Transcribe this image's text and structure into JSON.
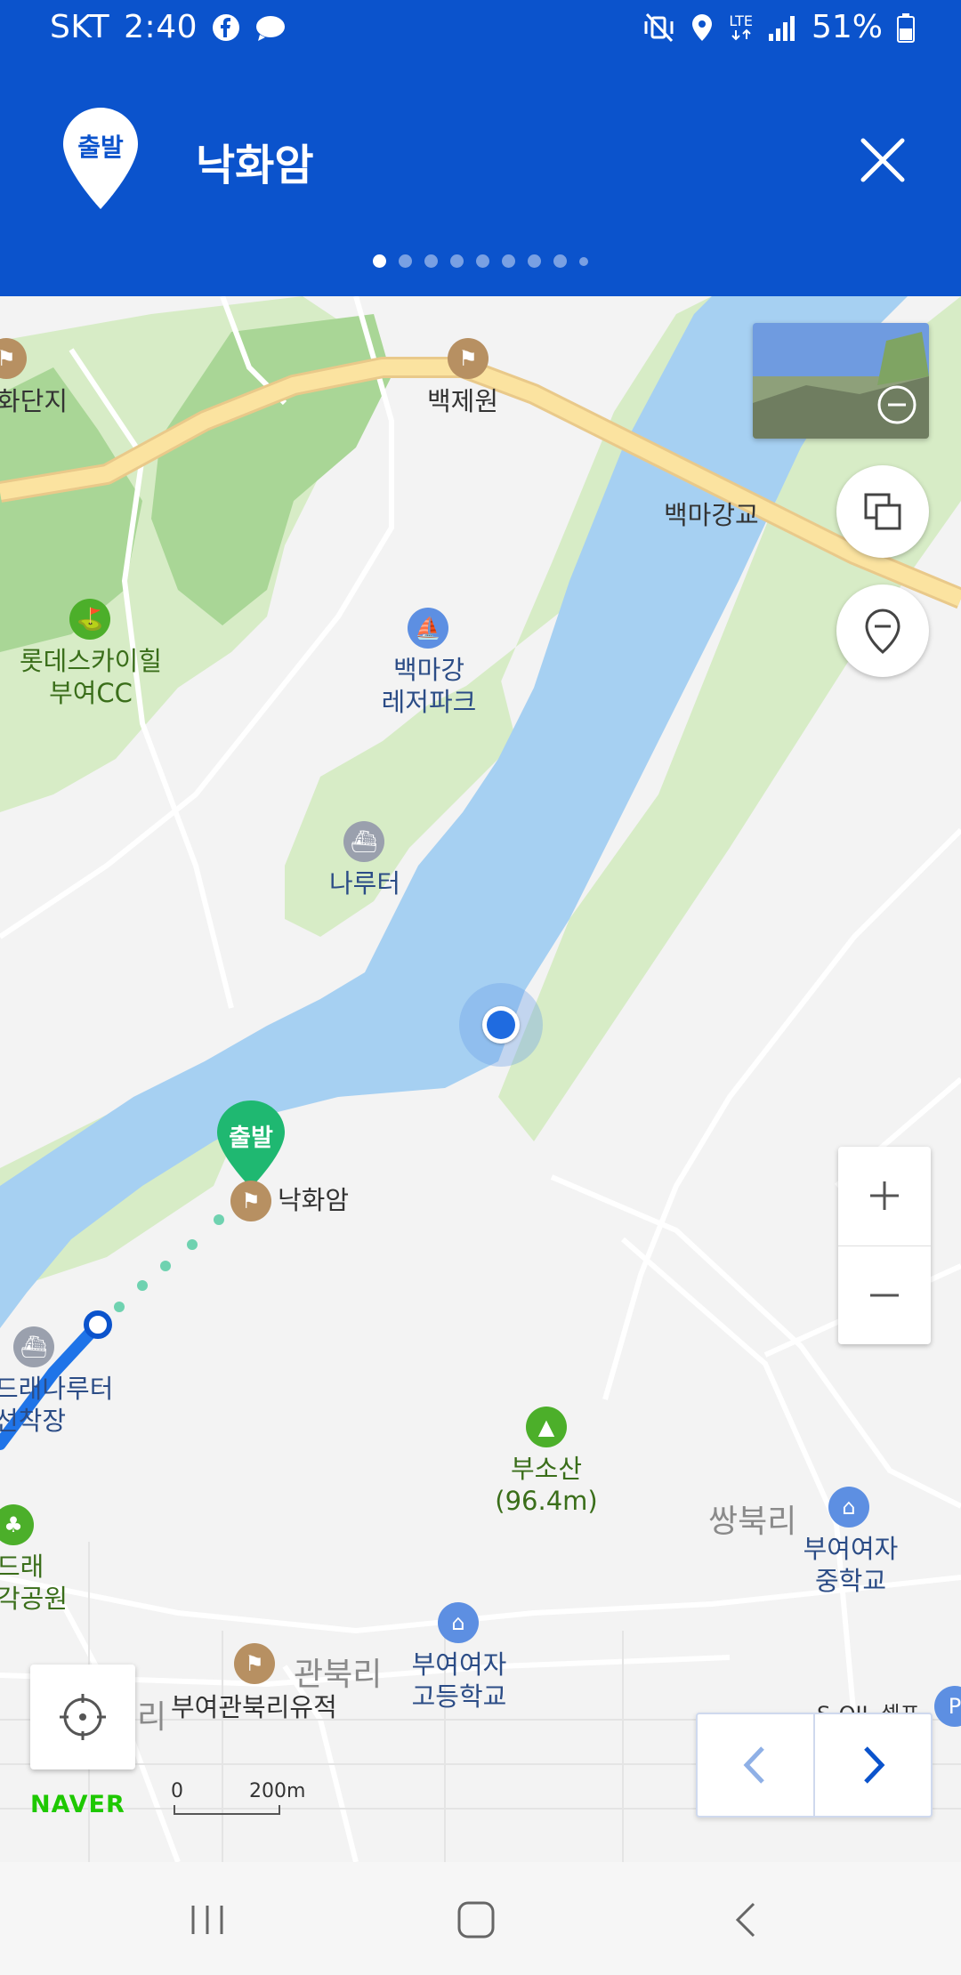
{
  "status": {
    "carrier": "SKT",
    "time": "2:40",
    "network": "LTE",
    "battery": "51%",
    "left_icons": [
      "facebook-icon",
      "chat-bubble-icon"
    ],
    "right_icons": [
      "mute-vibrate-icon",
      "location-icon",
      "lte-icon",
      "signal-icon",
      "battery-icon"
    ]
  },
  "header": {
    "badge": "출발",
    "title": "낙화암",
    "page_count": 9,
    "active_page": 1,
    "close_icon": "close-icon",
    "background": "#0b53cc"
  },
  "map": {
    "labels": {
      "baekjewon": "백제원",
      "hwadanji": "화단지",
      "baekma_bridge": "백마강교",
      "lotte_1": "롯데스카이힐",
      "lotte_2": "부여CC",
      "leisure_1": "백마강",
      "leisure_2": "레저파크",
      "naruteo": "나루터",
      "start_pin": "출발",
      "nakhwaam": "낙화암",
      "gudurae_1": "드래나루터",
      "gudurae_2": "선착장",
      "busosan_1": "부소산",
      "busosan_2": "(96.4m)",
      "ssangbuk": "쌍북리",
      "girls_middle_1": "부여여자",
      "girls_middle_2": "중학교",
      "gudurae_park_1": "드래",
      "gudurae_park_2": "각공원",
      "girls_high_1": "부여여자",
      "girls_high_2": "고등학교",
      "gwanbuk": "관북리",
      "ri": "리",
      "gwanbuk_site": "부여관북리유적",
      "soil": "S-OIL 셀프"
    },
    "scale": {
      "zero": "0",
      "distance": "200m"
    },
    "brand": "NAVER",
    "colors": {
      "water": "#a6d0f2",
      "park": "#d7ecc6",
      "forest": "#a9d696",
      "road_major": "#fbe3a0",
      "accent": "#0b53cc",
      "start_pin": "#1fb871"
    }
  }
}
